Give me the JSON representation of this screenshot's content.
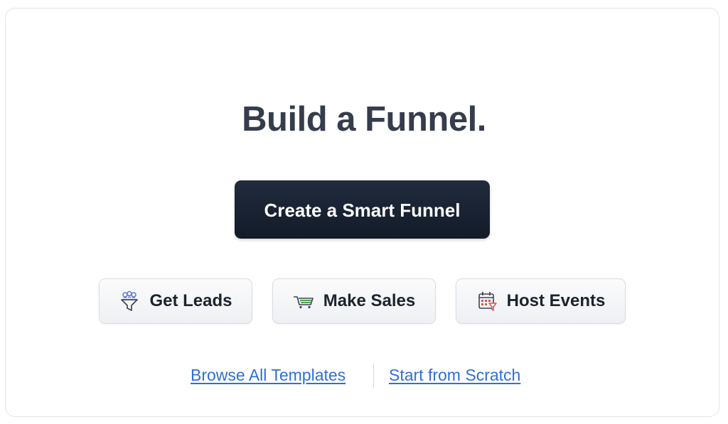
{
  "title": "Build a Funnel.",
  "primary_button": {
    "label": "Create a Smart Funnel"
  },
  "options": [
    {
      "label": "Get Leads",
      "icon": "funnel-people-icon",
      "icon_color": "#5b7fd6"
    },
    {
      "label": "Make Sales",
      "icon": "shopping-cart-icon",
      "icon_color": "#3f9a3c"
    },
    {
      "label": "Host Events",
      "icon": "calendar-icon",
      "icon_color": "#d9534f"
    }
  ],
  "links": {
    "browse": "Browse All Templates",
    "scratch": "Start from Scratch"
  },
  "colors": {
    "title": "#353d4d",
    "primary_bg": "#1a2333",
    "link": "#2f6fd8"
  }
}
